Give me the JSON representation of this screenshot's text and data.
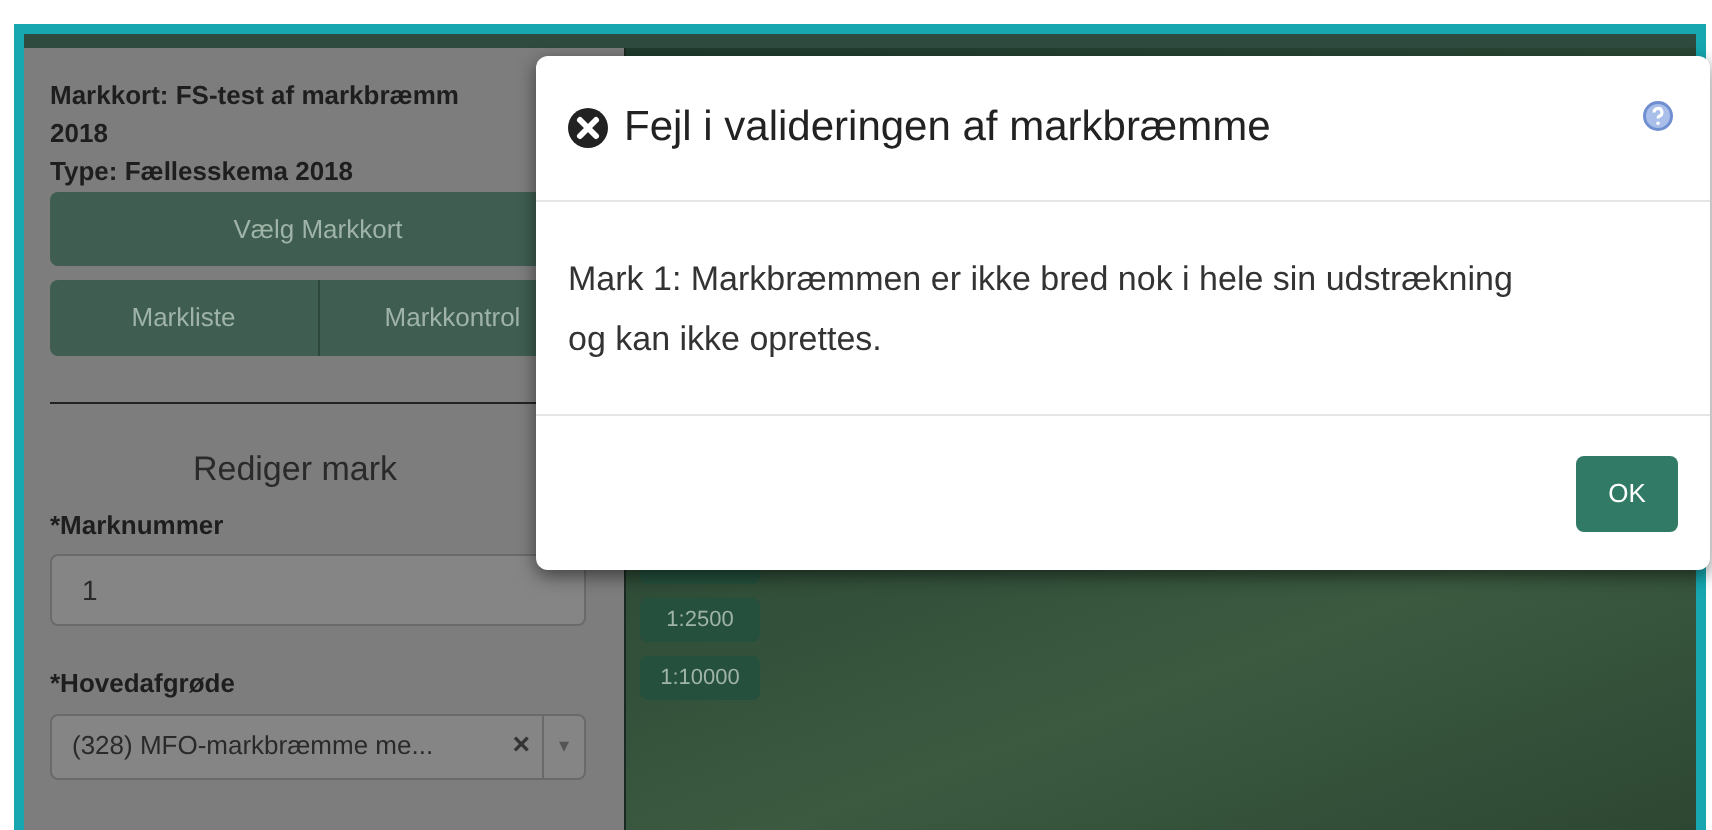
{
  "sidebar": {
    "map_title": "Markkort: FS-test af markbræmm 2018",
    "type_line": "Type: Fællesskema 2018",
    "choose_button": "Vælg Markkort",
    "tabs": [
      {
        "label": "Markliste"
      },
      {
        "label": "Markkontrol"
      }
    ],
    "section_title": "Rediger mark",
    "fields": [
      {
        "kind": "input",
        "label": "*Marknummer",
        "value": "1"
      },
      {
        "kind": "select",
        "label": "*Hovedafgrøde",
        "value": "(328) MFO-markbræmme me...",
        "clear": "×",
        "arrow": "▾"
      }
    ]
  },
  "map": {
    "scale_buttons": [
      "1:2500",
      "1:10000"
    ]
  },
  "dialog": {
    "title": "Fejl i valideringen af markbræmme",
    "message": "Mark 1: Markbræmmen er ikke bred nok i hele sin udstrækning og kan ikke oprettes.",
    "buttons": [
      "OK"
    ]
  }
}
